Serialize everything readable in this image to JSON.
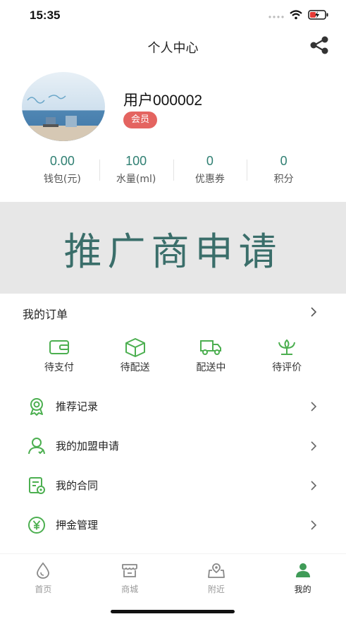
{
  "status": {
    "time": "15:35"
  },
  "nav": {
    "title": "个人中心"
  },
  "profile": {
    "username": "用户000002",
    "badge": "会员"
  },
  "stats": [
    {
      "value": "0.00",
      "label": "钱包(元)"
    },
    {
      "value": "100",
      "label": "水量(ml)"
    },
    {
      "value": "0",
      "label": "优惠券"
    },
    {
      "value": "0",
      "label": "积分"
    }
  ],
  "promo": {
    "text": "推广商申请"
  },
  "orders": {
    "title": "我的订单",
    "statuses": [
      {
        "label": "待支付",
        "icon": "wallet-icon"
      },
      {
        "label": "待配送",
        "icon": "package-icon"
      },
      {
        "label": "配送中",
        "icon": "truck-icon"
      },
      {
        "label": "待评价",
        "icon": "flower-icon"
      }
    ]
  },
  "menu": [
    {
      "label": "推荐记录",
      "icon": "award-icon"
    },
    {
      "label": "我的加盟申请",
      "icon": "user-icon"
    },
    {
      "label": "我的合同",
      "icon": "contract-icon"
    },
    {
      "label": "押金管理",
      "icon": "yen-icon"
    }
  ],
  "tabs": [
    {
      "label": "首页",
      "icon": "water-drop-icon"
    },
    {
      "label": "商城",
      "icon": "store-icon"
    },
    {
      "label": "附近",
      "icon": "location-icon"
    },
    {
      "label": "我的",
      "icon": "person-icon"
    }
  ],
  "colors": {
    "accent": "#2f7f72",
    "icon_green": "#4caf50",
    "badge": "#e46460",
    "banner_bg": "#e7e7e7",
    "banner_text": "#3a6e6a"
  }
}
